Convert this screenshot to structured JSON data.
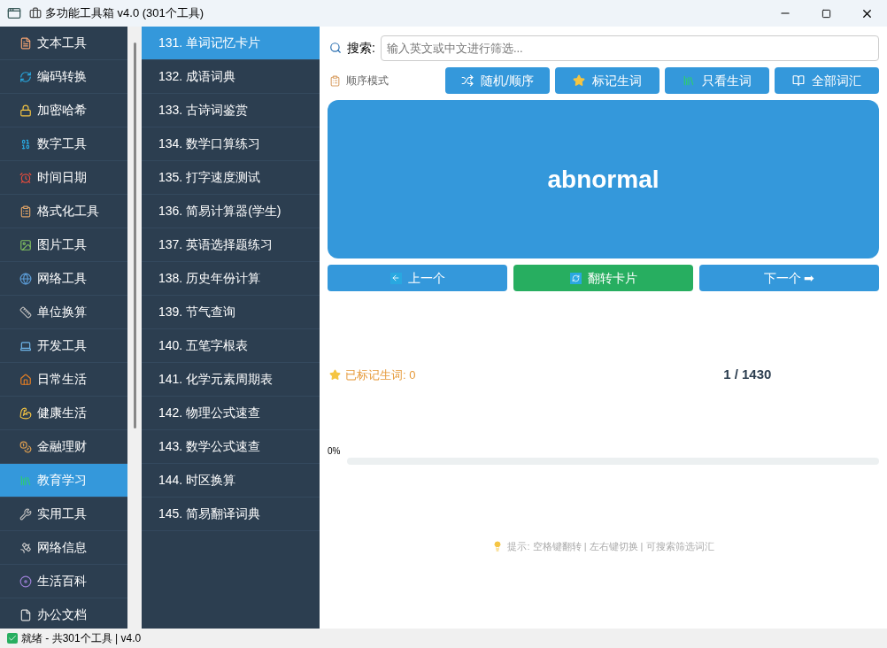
{
  "window": {
    "title": "多功能工具箱 v4.0 (301个工具)"
  },
  "sidebar": {
    "items": [
      {
        "label": "文本工具",
        "selected": false
      },
      {
        "label": "编码转换",
        "selected": false
      },
      {
        "label": "加密哈希",
        "selected": false
      },
      {
        "label": "数字工具",
        "selected": false
      },
      {
        "label": "时间日期",
        "selected": false
      },
      {
        "label": "格式化工具",
        "selected": false
      },
      {
        "label": "图片工具",
        "selected": false
      },
      {
        "label": "网络工具",
        "selected": false
      },
      {
        "label": "单位换算",
        "selected": false
      },
      {
        "label": "开发工具",
        "selected": false
      },
      {
        "label": "日常生活",
        "selected": false
      },
      {
        "label": "健康生活",
        "selected": false
      },
      {
        "label": "金融理财",
        "selected": false
      },
      {
        "label": "教育学习",
        "selected": true
      },
      {
        "label": "实用工具",
        "selected": false
      },
      {
        "label": "网络信息",
        "selected": false
      },
      {
        "label": "生活百科",
        "selected": false
      },
      {
        "label": "办公文档",
        "selected": false
      }
    ]
  },
  "tools": [
    {
      "label": "131. 单词记忆卡片",
      "selected": true
    },
    {
      "label": "132. 成语词典",
      "selected": false
    },
    {
      "label": "133. 古诗词鉴赏",
      "selected": false
    },
    {
      "label": "134. 数学口算练习",
      "selected": false
    },
    {
      "label": "135. 打字速度测试",
      "selected": false
    },
    {
      "label": "136. 简易计算器(学生)",
      "selected": false
    },
    {
      "label": "137. 英语选择题练习",
      "selected": false
    },
    {
      "label": "138. 历史年份计算",
      "selected": false
    },
    {
      "label": "139. 节气查询",
      "selected": false
    },
    {
      "label": "140. 五笔字根表",
      "selected": false
    },
    {
      "label": "141. 化学元素周期表",
      "selected": false
    },
    {
      "label": "142. 物理公式速查",
      "selected": false
    },
    {
      "label": "143. 数学公式速查",
      "selected": false
    },
    {
      "label": "144. 时区换算",
      "selected": false
    },
    {
      "label": "145. 简易翻译词典",
      "selected": false
    }
  ],
  "search": {
    "label": "搜索:",
    "placeholder": "输入英文或中文进行筛选..."
  },
  "mode": "顺序模式",
  "mode_buttons": [
    {
      "label": "随机/顺序"
    },
    {
      "label": "标记生词"
    },
    {
      "label": "只看生词"
    },
    {
      "label": "全部词汇"
    }
  ],
  "card": {
    "word": "abnormal"
  },
  "nav_buttons": [
    {
      "label": "上一个",
      "kind": "prev"
    },
    {
      "label": "翻转卡片",
      "kind": "flip"
    },
    {
      "label": "下一个 ➡",
      "kind": "next"
    }
  ],
  "marked": "已标记生词: 0",
  "counter": "1 / 1430",
  "progress": {
    "label": "0%",
    "level": 0
  },
  "hint": "提示: 空格键翻转 | 左右键切换 | 可搜索筛选词汇",
  "status_bar": "就绪 - 共301个工具 | v4.0"
}
